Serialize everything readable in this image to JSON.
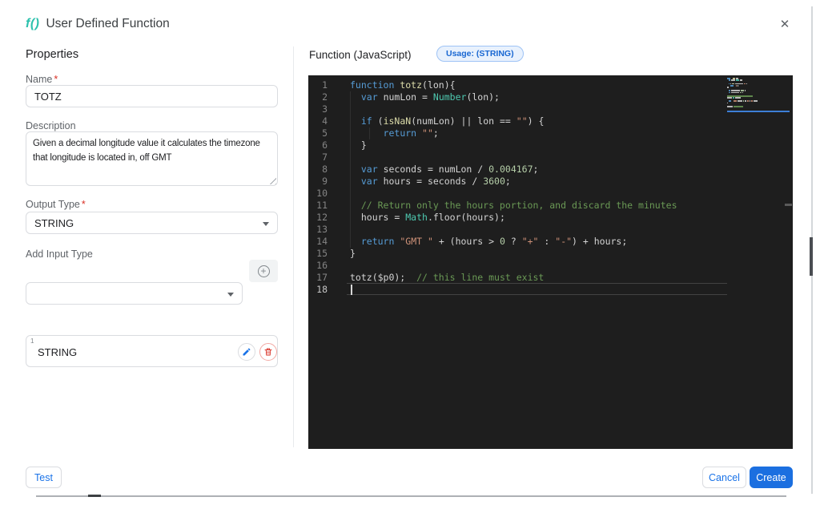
{
  "dialog": {
    "title_icon": "f()",
    "title": "User Defined Function",
    "close_icon": "✕"
  },
  "properties": {
    "heading": "Properties",
    "name": {
      "label": "Name",
      "required": "*",
      "value": "TOTZ"
    },
    "description": {
      "label": "Description",
      "value": "Given a decimal longitude value it calculates the timezone that longitude is located in, off GMT"
    },
    "output_type": {
      "label": "Output Type",
      "required": "*",
      "value": "STRING"
    },
    "add_input_type": {
      "label": "Add Input Type",
      "value": "",
      "add_icon": "+"
    },
    "input_types": [
      {
        "index": "1",
        "type": "STRING"
      }
    ]
  },
  "editor": {
    "header": "Function (JavaScript)",
    "usage_badge": "Usage: (STRING)",
    "cursor_line": 18,
    "code_lines": [
      {
        "n": 1,
        "tokens": [
          [
            "kw",
            "function"
          ],
          [
            "pln",
            " "
          ],
          [
            "fn",
            "totz"
          ],
          [
            "pln",
            "(lon){"
          ]
        ]
      },
      {
        "n": 2,
        "tokens": [
          [
            "pln",
            "  "
          ],
          [
            "kw",
            "var"
          ],
          [
            "pln",
            " numLon = "
          ],
          [
            "cls",
            "Number"
          ],
          [
            "pln",
            "(lon);"
          ]
        ]
      },
      {
        "n": 3,
        "tokens": []
      },
      {
        "n": 4,
        "tokens": [
          [
            "pln",
            "  "
          ],
          [
            "kw",
            "if"
          ],
          [
            "pln",
            " ("
          ],
          [
            "fn",
            "isNaN"
          ],
          [
            "pln",
            "(numLon) || lon == "
          ],
          [
            "str",
            "\"\""
          ],
          [
            "pln",
            ") {"
          ]
        ]
      },
      {
        "n": 5,
        "tokens": [
          [
            "pln",
            "      "
          ],
          [
            "kw",
            "return"
          ],
          [
            "pln",
            " "
          ],
          [
            "str",
            "\"\""
          ],
          [
            "pln",
            ";"
          ]
        ]
      },
      {
        "n": 6,
        "tokens": [
          [
            "pln",
            "  }"
          ]
        ]
      },
      {
        "n": 7,
        "tokens": []
      },
      {
        "n": 8,
        "tokens": [
          [
            "pln",
            "  "
          ],
          [
            "kw",
            "var"
          ],
          [
            "pln",
            " seconds = numLon / "
          ],
          [
            "num",
            "0.004167"
          ],
          [
            "pln",
            ";"
          ]
        ]
      },
      {
        "n": 9,
        "tokens": [
          [
            "pln",
            "  "
          ],
          [
            "kw",
            "var"
          ],
          [
            "pln",
            " hours = seconds / "
          ],
          [
            "num",
            "3600"
          ],
          [
            "pln",
            ";"
          ]
        ]
      },
      {
        "n": 10,
        "tokens": []
      },
      {
        "n": 11,
        "tokens": [
          [
            "com",
            "  // Return only the hours portion, and discard the minutes"
          ]
        ]
      },
      {
        "n": 12,
        "tokens": [
          [
            "pln",
            "  hours = "
          ],
          [
            "cls",
            "Math"
          ],
          [
            "pln",
            ".floor(hours);"
          ]
        ]
      },
      {
        "n": 13,
        "tokens": []
      },
      {
        "n": 14,
        "tokens": [
          [
            "pln",
            "  "
          ],
          [
            "kw",
            "return"
          ],
          [
            "pln",
            " "
          ],
          [
            "str",
            "\"GMT \""
          ],
          [
            "pln",
            " + (hours > "
          ],
          [
            "num",
            "0"
          ],
          [
            "pln",
            " ? "
          ],
          [
            "str",
            "\"+\""
          ],
          [
            "pln",
            " : "
          ],
          [
            "str",
            "\"-\""
          ],
          [
            "pln",
            ") + hours;"
          ]
        ]
      },
      {
        "n": 15,
        "tokens": [
          [
            "pln",
            "}"
          ]
        ]
      },
      {
        "n": 16,
        "tokens": []
      },
      {
        "n": 17,
        "tokens": [
          [
            "pln",
            "totz($p0);  "
          ],
          [
            "com",
            "// this line must exist"
          ]
        ]
      },
      {
        "n": 18,
        "tokens": []
      }
    ]
  },
  "footer": {
    "test": "Test",
    "cancel": "Cancel",
    "create": "Create"
  },
  "colors": {
    "accent_teal": "#2cc1ad",
    "primary_blue": "#1b6fe0",
    "link_blue": "#1a73e8",
    "required_red": "#d93025",
    "badge_bg": "#e8f1fd",
    "badge_border": "#9ec3f5",
    "badge_text": "#1967d2",
    "editor_bg": "#1e1e1e"
  }
}
